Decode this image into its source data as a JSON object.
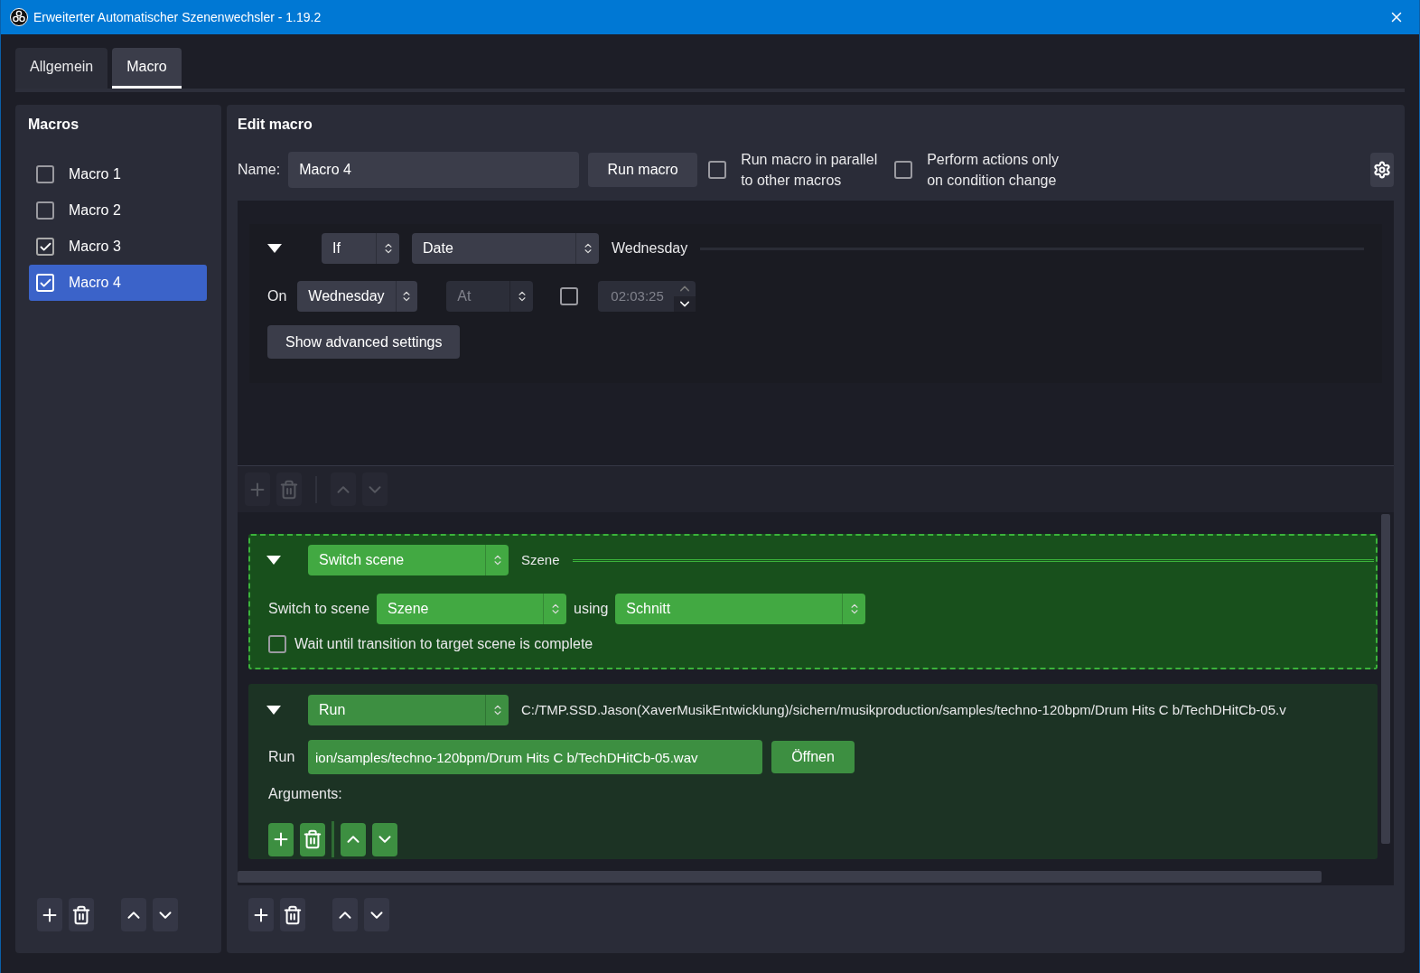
{
  "window": {
    "title": "Erweiterter Automatischer Szenenwechsler - 1.19.2"
  },
  "tabs": [
    {
      "label": "Allgemein",
      "selected": false
    },
    {
      "label": "Macro",
      "selected": true
    }
  ],
  "macros": {
    "title": "Macros",
    "items": [
      {
        "label": "Macro 1",
        "checked": false,
        "selected": false
      },
      {
        "label": "Macro 2",
        "checked": false,
        "selected": false
      },
      {
        "label": "Macro 3",
        "checked": true,
        "selected": false
      },
      {
        "label": "Macro 4",
        "checked": true,
        "selected": true
      }
    ]
  },
  "edit": {
    "title": "Edit macro",
    "name_label": "Name:",
    "name_value": "Macro 4",
    "run_button": "Run macro",
    "options": [
      {
        "label": "Run macro in parallel to other macros",
        "checked": false
      },
      {
        "label": "Perform actions only on condition change",
        "checked": false
      }
    ]
  },
  "condition": {
    "expanded": true,
    "logic": "If",
    "type": "Date",
    "summary": "Wednesday",
    "on_label": "On",
    "day": "Wednesday",
    "time_mode": "At",
    "time_checked": false,
    "time": "02:03:25",
    "advanced_button": "Show advanced settings"
  },
  "actions": [
    {
      "kind": "switch_scene",
      "expanded": true,
      "selected": true,
      "type": "Switch scene",
      "summary": "Szene",
      "scene_label": "Switch to scene",
      "scene": "Szene",
      "using_label": "using",
      "transition": "Schnitt",
      "wait_label": "Wait until transition to target scene is complete",
      "wait_checked": false
    },
    {
      "kind": "run",
      "expanded": true,
      "selected": false,
      "type": "Run",
      "summary": "C:/TMP.SSD.Jason(XaverMusikEntwicklung)/sichern/musikproduction/samples/techno-120bpm/Drum Hits C b/TechDHitCb-05.v",
      "run_label": "Run",
      "path": "ion/samples/techno-120bpm/Drum Hits C b/TechDHitCb-05.wav",
      "open_button": "Öffnen",
      "arguments_label": "Arguments:"
    }
  ]
}
